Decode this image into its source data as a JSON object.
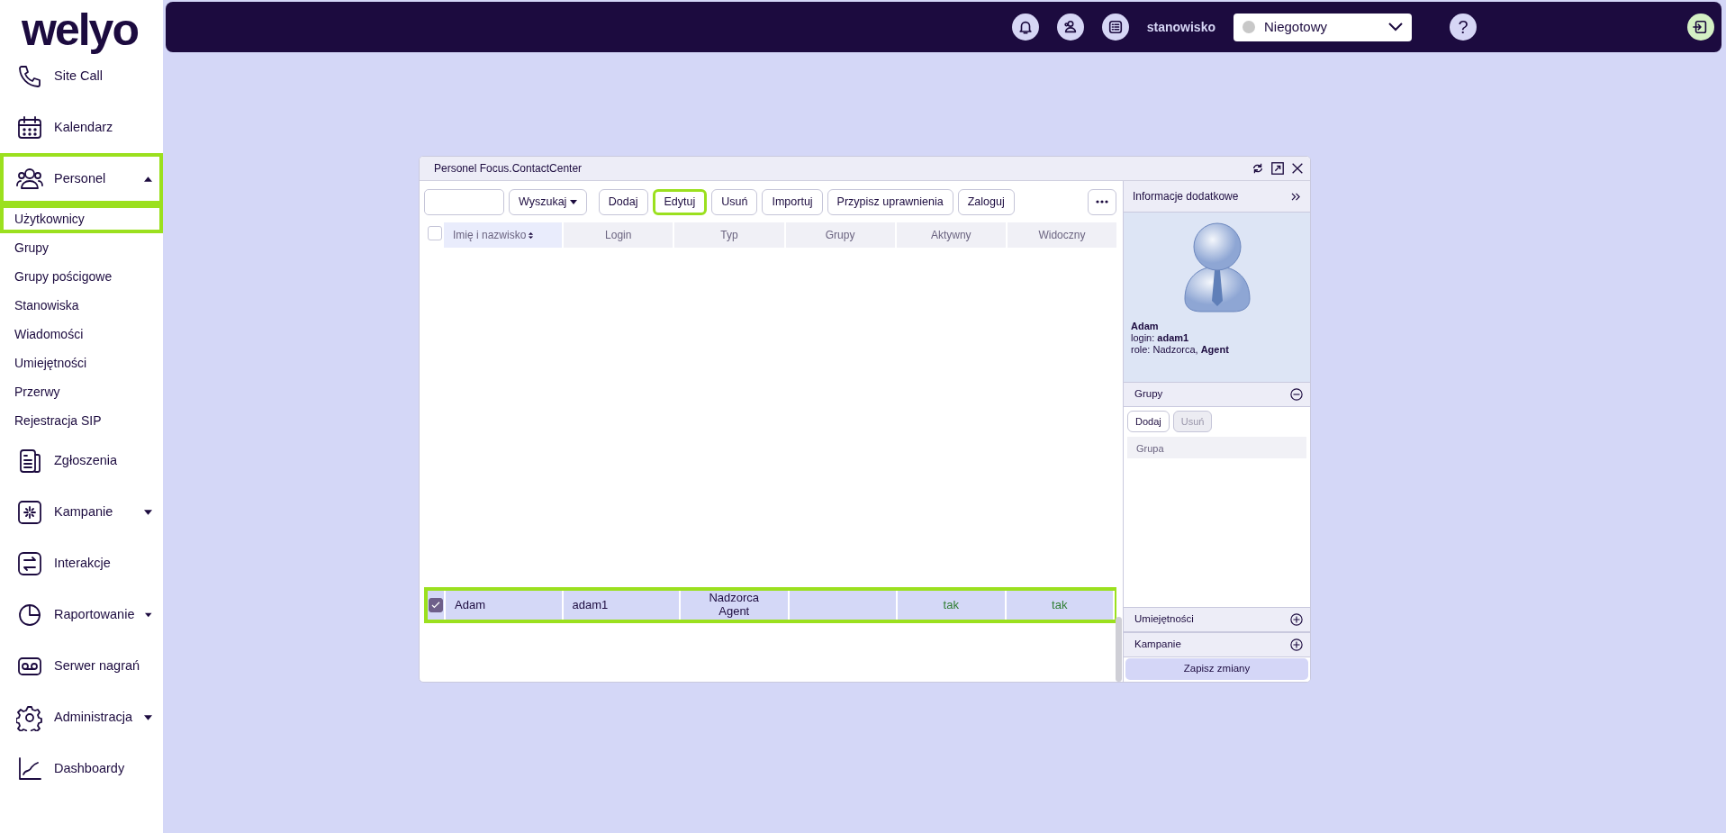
{
  "logo": "welyo",
  "sidebar": {
    "items": [
      {
        "label": "Site Call"
      },
      {
        "label": "Kalendarz"
      },
      {
        "label": "Personel",
        "expanded": true,
        "highlighted": true,
        "children": [
          {
            "label": "Użytkownicy",
            "highlighted": true
          },
          {
            "label": "Grupy",
            "highlighted": false
          },
          {
            "label": "Grupy pościgowe",
            "highlighted": false
          },
          {
            "label": "Stanowiska",
            "highlighted": false
          },
          {
            "label": "Wiadomości",
            "highlighted": false
          },
          {
            "label": "Umiejętności",
            "highlighted": false
          },
          {
            "label": "Przerwy",
            "highlighted": false
          },
          {
            "label": "Rejestracja SIP",
            "highlighted": false
          }
        ]
      },
      {
        "label": "Zgłoszenia"
      },
      {
        "label": "Kampanie",
        "expanded": false
      },
      {
        "label": "Interakcje"
      },
      {
        "label": "Raportowanie",
        "expanded": false
      },
      {
        "label": "Serwer nagrań"
      },
      {
        "label": "Administracja",
        "expanded": false
      },
      {
        "label": "Dashboardy"
      }
    ]
  },
  "topbar": {
    "station": "stanowisko",
    "status": {
      "value": "Niegotowy",
      "color": "#c8c8c8"
    },
    "help": "?"
  },
  "window": {
    "title": "Personel Focus.ContactCenter",
    "toolbar": {
      "search_button": "Wyszukaj",
      "buttons": [
        {
          "label": "Dodaj",
          "highlighted": false
        },
        {
          "label": "Edytuj",
          "highlighted": true
        },
        {
          "label": "Usuń",
          "highlighted": false
        },
        {
          "label": "Importuj",
          "highlighted": false
        },
        {
          "label": "Przypisz uprawnienia",
          "highlighted": false
        },
        {
          "label": "Zaloguj",
          "highlighted": false
        }
      ]
    },
    "table": {
      "all_checked": false,
      "columns": [
        {
          "label": "Imię i nazwisko",
          "sorted": true
        },
        {
          "label": "Login",
          "sorted": false
        },
        {
          "label": "Typ",
          "sorted": false
        },
        {
          "label": "Grupy",
          "sorted": false
        },
        {
          "label": "Aktywny",
          "sorted": false
        },
        {
          "label": "Widoczny",
          "sorted": false
        }
      ],
      "rows": [
        {
          "checked": true,
          "highlighted": true,
          "name": "Adam",
          "login": "adam1",
          "type": [
            "Nadzorca",
            "Agent"
          ],
          "active": "tak",
          "visible": "tak"
        }
      ]
    },
    "panel": {
      "header": "Informacje dodatkowe",
      "user": {
        "name": "Adam",
        "login": "login: **adam1**",
        "role": "role: Nadzorca, **Agent**"
      },
      "sections": [
        {
          "title": "Grupy",
          "expanded": true,
          "buttons": [
            {
              "label": "Dodaj",
              "disabled": false
            },
            {
              "label": "Usuń",
              "disabled": true
            }
          ],
          "column": "Grupa"
        },
        {
          "title": "Umiejętności",
          "expanded": false
        },
        {
          "title": "Kampanie",
          "expanded": false
        }
      ],
      "save": "Zapisz zmiany"
    }
  }
}
